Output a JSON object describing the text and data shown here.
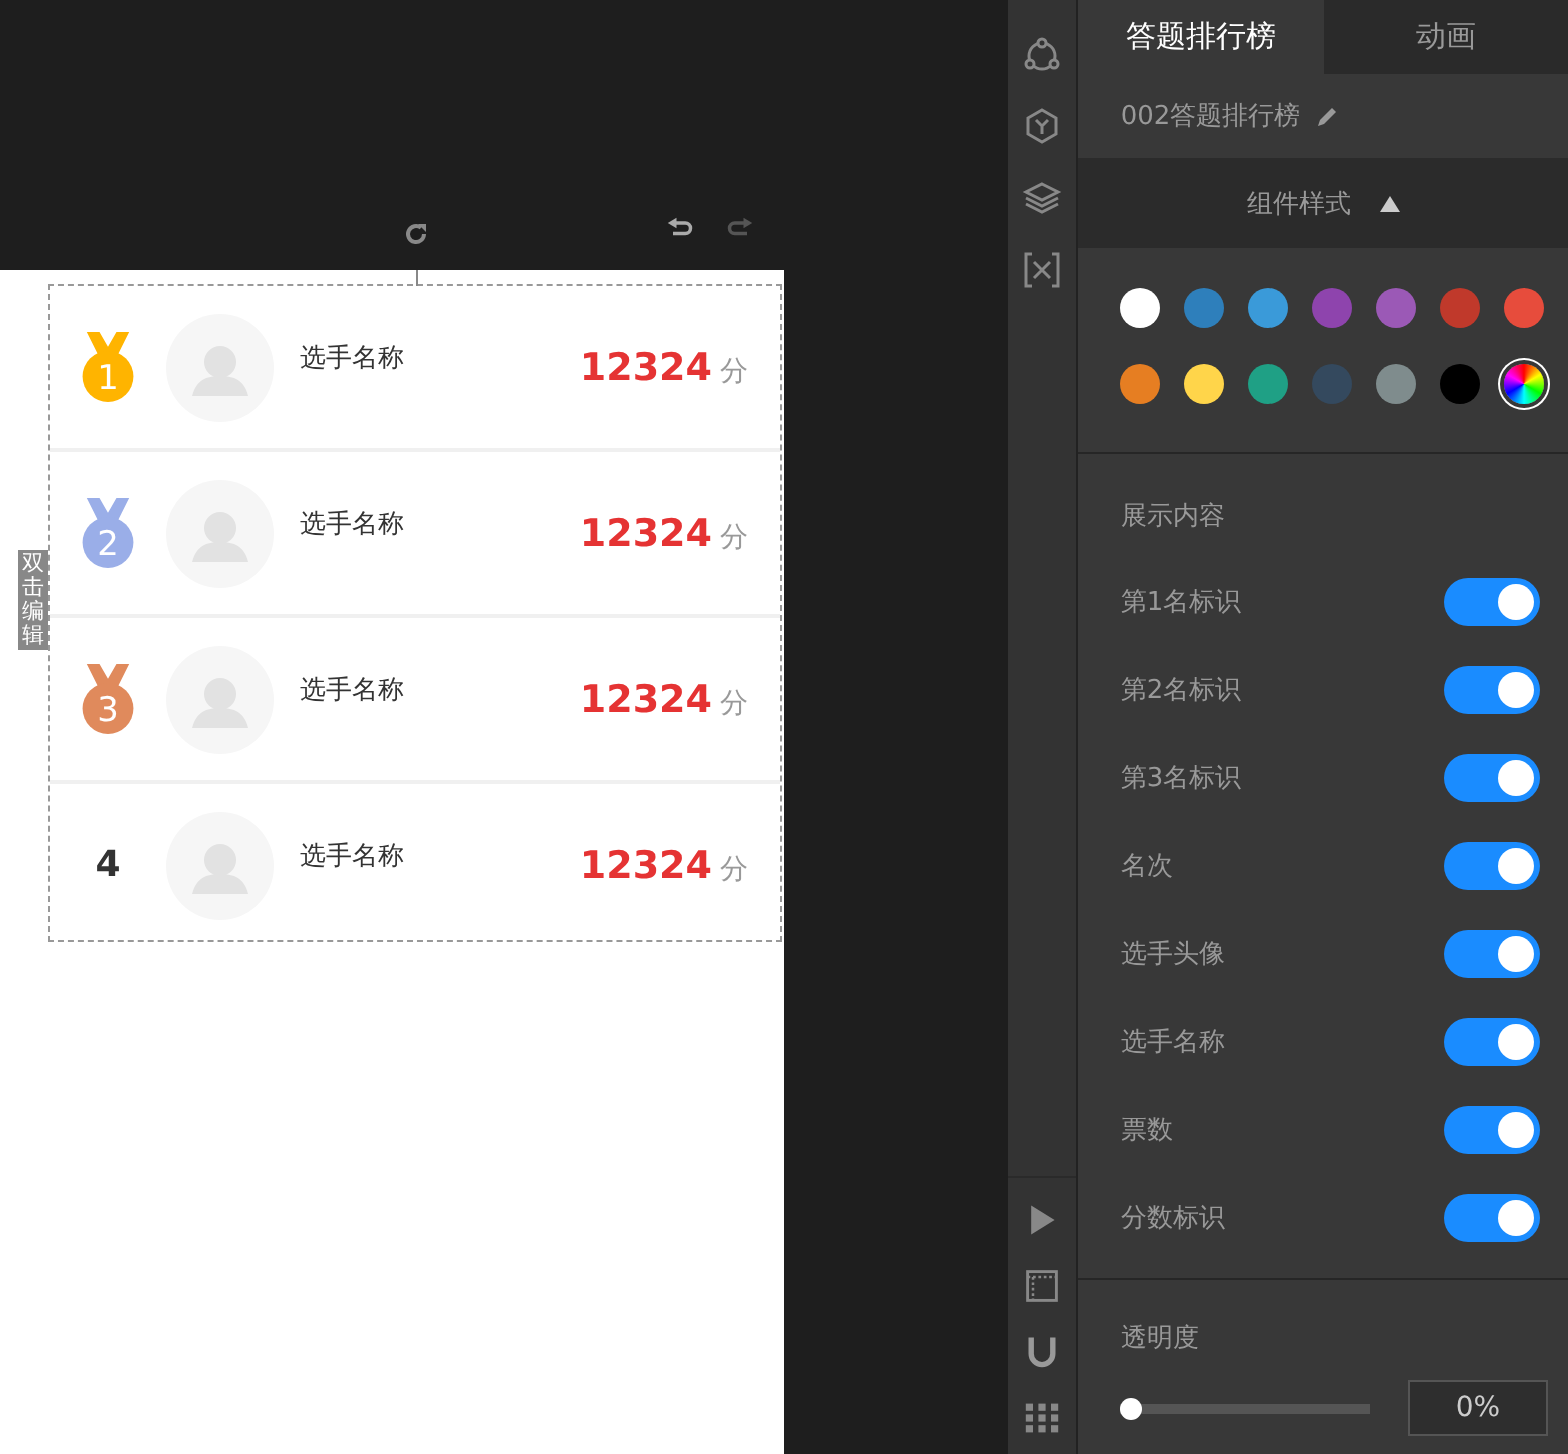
{
  "ranking": [
    {
      "rank": "1",
      "kind": "medal",
      "color": "#ffb400",
      "name": "选手名称",
      "score": "12324",
      "unit": "分"
    },
    {
      "rank": "2",
      "kind": "medal",
      "color": "#9aaee8",
      "name": "选手名称",
      "score": "12324",
      "unit": "分"
    },
    {
      "rank": "3",
      "kind": "medal",
      "color": "#e08a5c",
      "name": "选手名称",
      "score": "12324",
      "unit": "分"
    },
    {
      "rank": "4",
      "kind": "number",
      "name": "选手名称",
      "score": "12324",
      "unit": "分"
    }
  ],
  "edit_hint": "双击编辑",
  "tabs": [
    {
      "label": "答题排行榜",
      "selected": true
    },
    {
      "label": "动画",
      "selected": false
    }
  ],
  "component_name": "002答题排行榜",
  "section_title": "组件样式",
  "swatches": [
    {
      "kind": "color",
      "color": "#ffffff",
      "selected": false
    },
    {
      "kind": "color",
      "color": "#2e7fbb",
      "selected": false
    },
    {
      "kind": "color",
      "color": "#3a9ad9",
      "selected": false
    },
    {
      "kind": "color",
      "color": "#8e44ad",
      "selected": false
    },
    {
      "kind": "color",
      "color": "#9b59b6",
      "selected": false
    },
    {
      "kind": "color",
      "color": "#c0392b",
      "selected": false
    },
    {
      "kind": "color",
      "color": "#e74c3c",
      "selected": false
    },
    {
      "kind": "color",
      "color": "#e67e22",
      "selected": false
    },
    {
      "kind": "color",
      "color": "#ffd54a",
      "selected": false
    },
    {
      "kind": "color",
      "color": "#1fa085",
      "selected": false
    },
    {
      "kind": "color",
      "color": "#34495e",
      "selected": false
    },
    {
      "kind": "color",
      "color": "#7f8c8d",
      "selected": false
    },
    {
      "kind": "color",
      "color": "#000000",
      "selected": false
    },
    {
      "kind": "picker",
      "selected": true
    }
  ],
  "display_title": "展示内容",
  "toggles": [
    {
      "label": "第1名标识",
      "on": true
    },
    {
      "label": "第2名标识",
      "on": true
    },
    {
      "label": "第3名标识",
      "on": true
    },
    {
      "label": "名次",
      "on": true
    },
    {
      "label": "选手头像",
      "on": true
    },
    {
      "label": "选手名称",
      "on": true
    },
    {
      "label": "票数",
      "on": true
    },
    {
      "label": "分数标识",
      "on": true
    }
  ],
  "opacity": {
    "label": "透明度",
    "level": 0,
    "value": "0%"
  }
}
